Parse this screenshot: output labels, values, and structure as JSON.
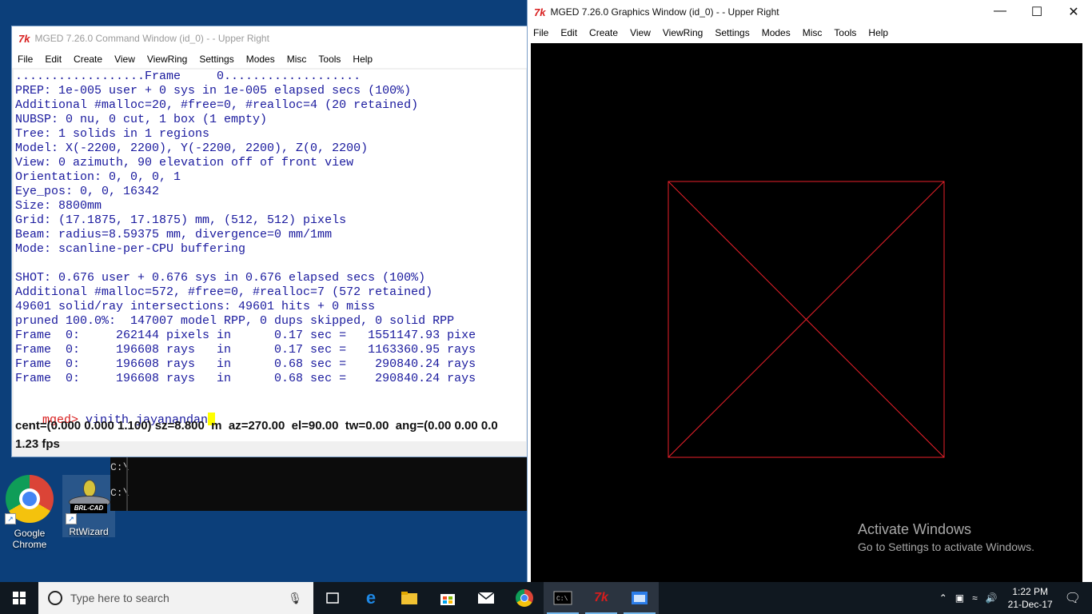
{
  "desktop": {
    "icons": [
      {
        "label_1": "Google",
        "label_2": "Chrome"
      },
      {
        "label_1": "RtWizard"
      }
    ],
    "brl_tag": "BRL-CAD"
  },
  "cmd_window": {
    "title": "MGED 7.26.0 Command Window (id_0) -  - Upper Right",
    "menu": [
      "File",
      "Edit",
      "Create",
      "View",
      "ViewRing",
      "Settings",
      "Modes",
      "Misc",
      "Tools",
      "Help"
    ],
    "lines": [
      "..................Frame     0...................",
      "PREP: 1e-005 user + 0 sys in 1e-005 elapsed secs (100%)",
      "Additional #malloc=20, #free=0, #realloc=4 (20 retained)",
      "NUBSP: 0 nu, 0 cut, 1 box (1 empty)",
      "Tree: 1 solids in 1 regions",
      "Model: X(-2200, 2200), Y(-2200, 2200), Z(0, 2200)",
      "View: 0 azimuth, 90 elevation off of front view",
      "Orientation: 0, 0, 0, 1",
      "Eye_pos: 0, 0, 16342",
      "Size: 8800mm",
      "Grid: (17.1875, 17.1875) mm, (512, 512) pixels",
      "Beam: radius=8.59375 mm, divergence=0 mm/1mm",
      "Mode: scanline-per-CPU buffering",
      "",
      "SHOT: 0.676 user + 0.676 sys in 0.676 elapsed secs (100%)",
      "Additional #malloc=572, #free=0, #realloc=7 (572 retained)",
      "49601 solid/ray intersections: 49601 hits + 0 miss",
      "pruned 100.0%:  147007 model RPP, 0 dups skipped, 0 solid RPP",
      "Frame  0:     262144 pixels in      0.17 sec =   1551147.93 pixe",
      "Frame  0:     196608 rays   in      0.17 sec =   1163360.95 rays",
      "Frame  0:     196608 rays   in      0.68 sec =    290840.24 rays",
      "Frame  0:     196608 rays   in      0.68 sec =    290840.24 rays"
    ],
    "prompt": "mged>",
    "input": " vinith jayanandan",
    "status": "cent=(0.000 0.000 1.100) sz=8.800  m  az=270.00  el=90.00  tw=0.00  ang=(0.00 0.00 0.0",
    "fps": "1.23 fps"
  },
  "bg_console": {
    "line1": "C:\\",
    "line2": "C:\\"
  },
  "gfx_window": {
    "title": "MGED 7.26.0 Graphics Window (id_0) -  - Upper Right",
    "menu": [
      "File",
      "Edit",
      "Create",
      "View",
      "ViewRing",
      "Settings",
      "Modes",
      "Misc",
      "Tools",
      "Help"
    ],
    "wire_color": "#e8202a"
  },
  "watermark": {
    "title": "Activate Windows",
    "subtitle": "Go to Settings to activate Windows."
  },
  "taskbar": {
    "search_placeholder": "Type here to search",
    "time": "1:22 PM",
    "date": "21-Dec-17"
  }
}
